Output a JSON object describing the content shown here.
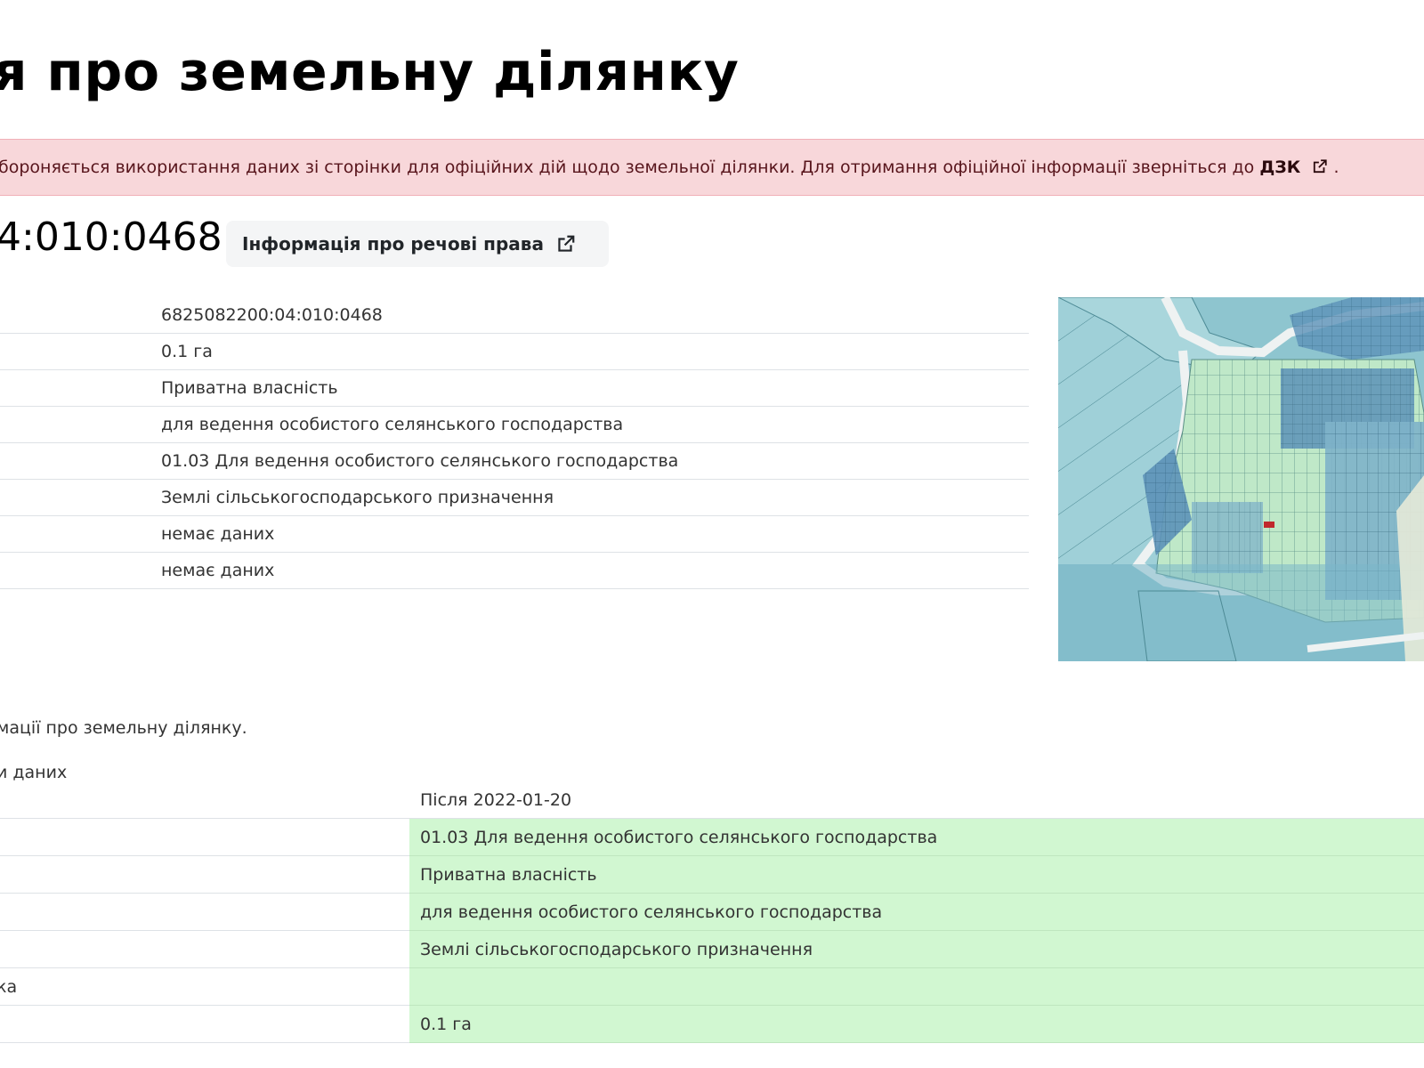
{
  "header": {
    "title": "я про земельну ділянку"
  },
  "alert": {
    "text": "бороняється використання даних зі сторінки для офіційних дій щодо земельної ділянки. Для отримання офіційної інформації зверніться до",
    "link_label": "ДЗК",
    "suffix": "."
  },
  "parcel": {
    "cadastral_number_visible": "4:010:0468",
    "rights_button_label": "Інформація про речові права"
  },
  "info": {
    "values": [
      "6825082200:04:010:0468",
      "0.1 га",
      "Приватна власність",
      "для ведення особистого селянського господарства",
      "01.03 Для ведення особистого селянського господарства",
      "Землі сільськогосподарського призначення",
      "немає даних",
      "немає даних"
    ]
  },
  "history": {
    "note": "мації про земельну ділянку.",
    "label": "и даних",
    "column_after": "Після 2022-01-20",
    "rows": [
      {
        "label": "",
        "after": "01.03 Для ведення особистого селянського господарства"
      },
      {
        "label": "",
        "after": "Приватна власність"
      },
      {
        "label": "",
        "after": "для ведення особистого селянського господарства"
      },
      {
        "label": "",
        "after": "Землі сільськогосподарського призначення"
      },
      {
        "label": "ка",
        "after": ""
      },
      {
        "label": "",
        "after": "0.1 га"
      }
    ]
  },
  "colors": {
    "alert_bg": "#f8d7da",
    "changed_bg": "#d1f7d1",
    "selected_parcel": "#c0282d"
  },
  "icons": {
    "external_link": "external-link-icon"
  }
}
